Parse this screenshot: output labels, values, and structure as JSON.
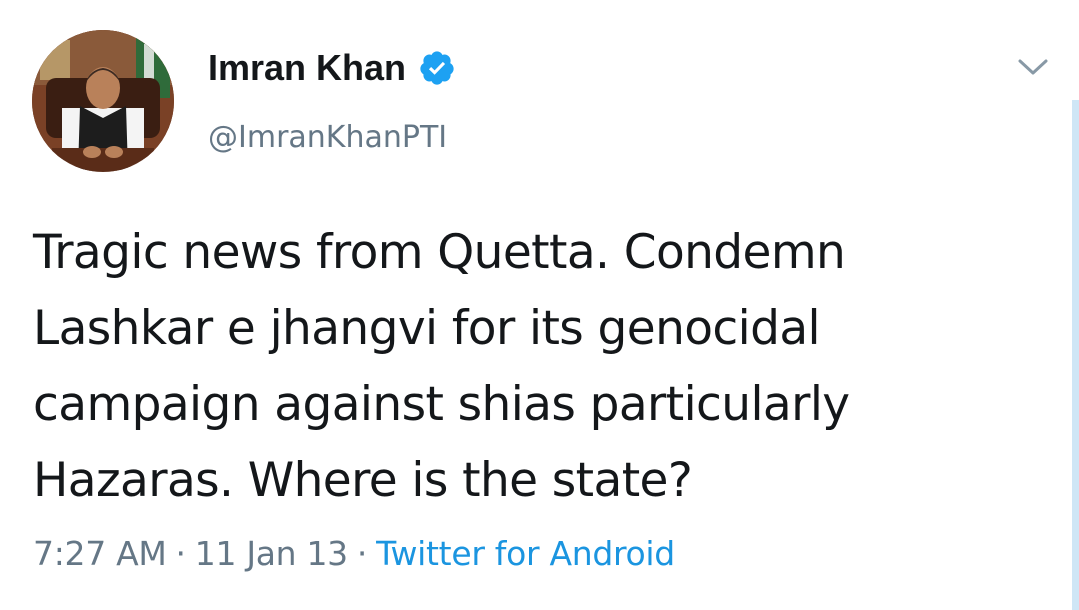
{
  "user": {
    "display_name": "Imran Khan",
    "handle": "@ImranKhanPTI",
    "verified_icon": "verified-badge-icon",
    "avatar_icon": "profile-photo"
  },
  "tweet": {
    "lines": [
      "Tragic news from Quetta. Condemn",
      "Lashkar e jhangvi for its genocidal",
      "campaign against shias particularly",
      "Hazaras. Where is the state?"
    ]
  },
  "meta": {
    "time": "7:27 AM",
    "separator": "·",
    "date": "11 Jan 13",
    "source": "Twitter for Android"
  },
  "menu": {
    "icon": "chevron-down-icon"
  },
  "colors": {
    "text": "#14171a",
    "secondary": "#657786",
    "link": "#1b95e0",
    "verified": "#1da1f2",
    "scrollbar": "#cfe6f6"
  }
}
